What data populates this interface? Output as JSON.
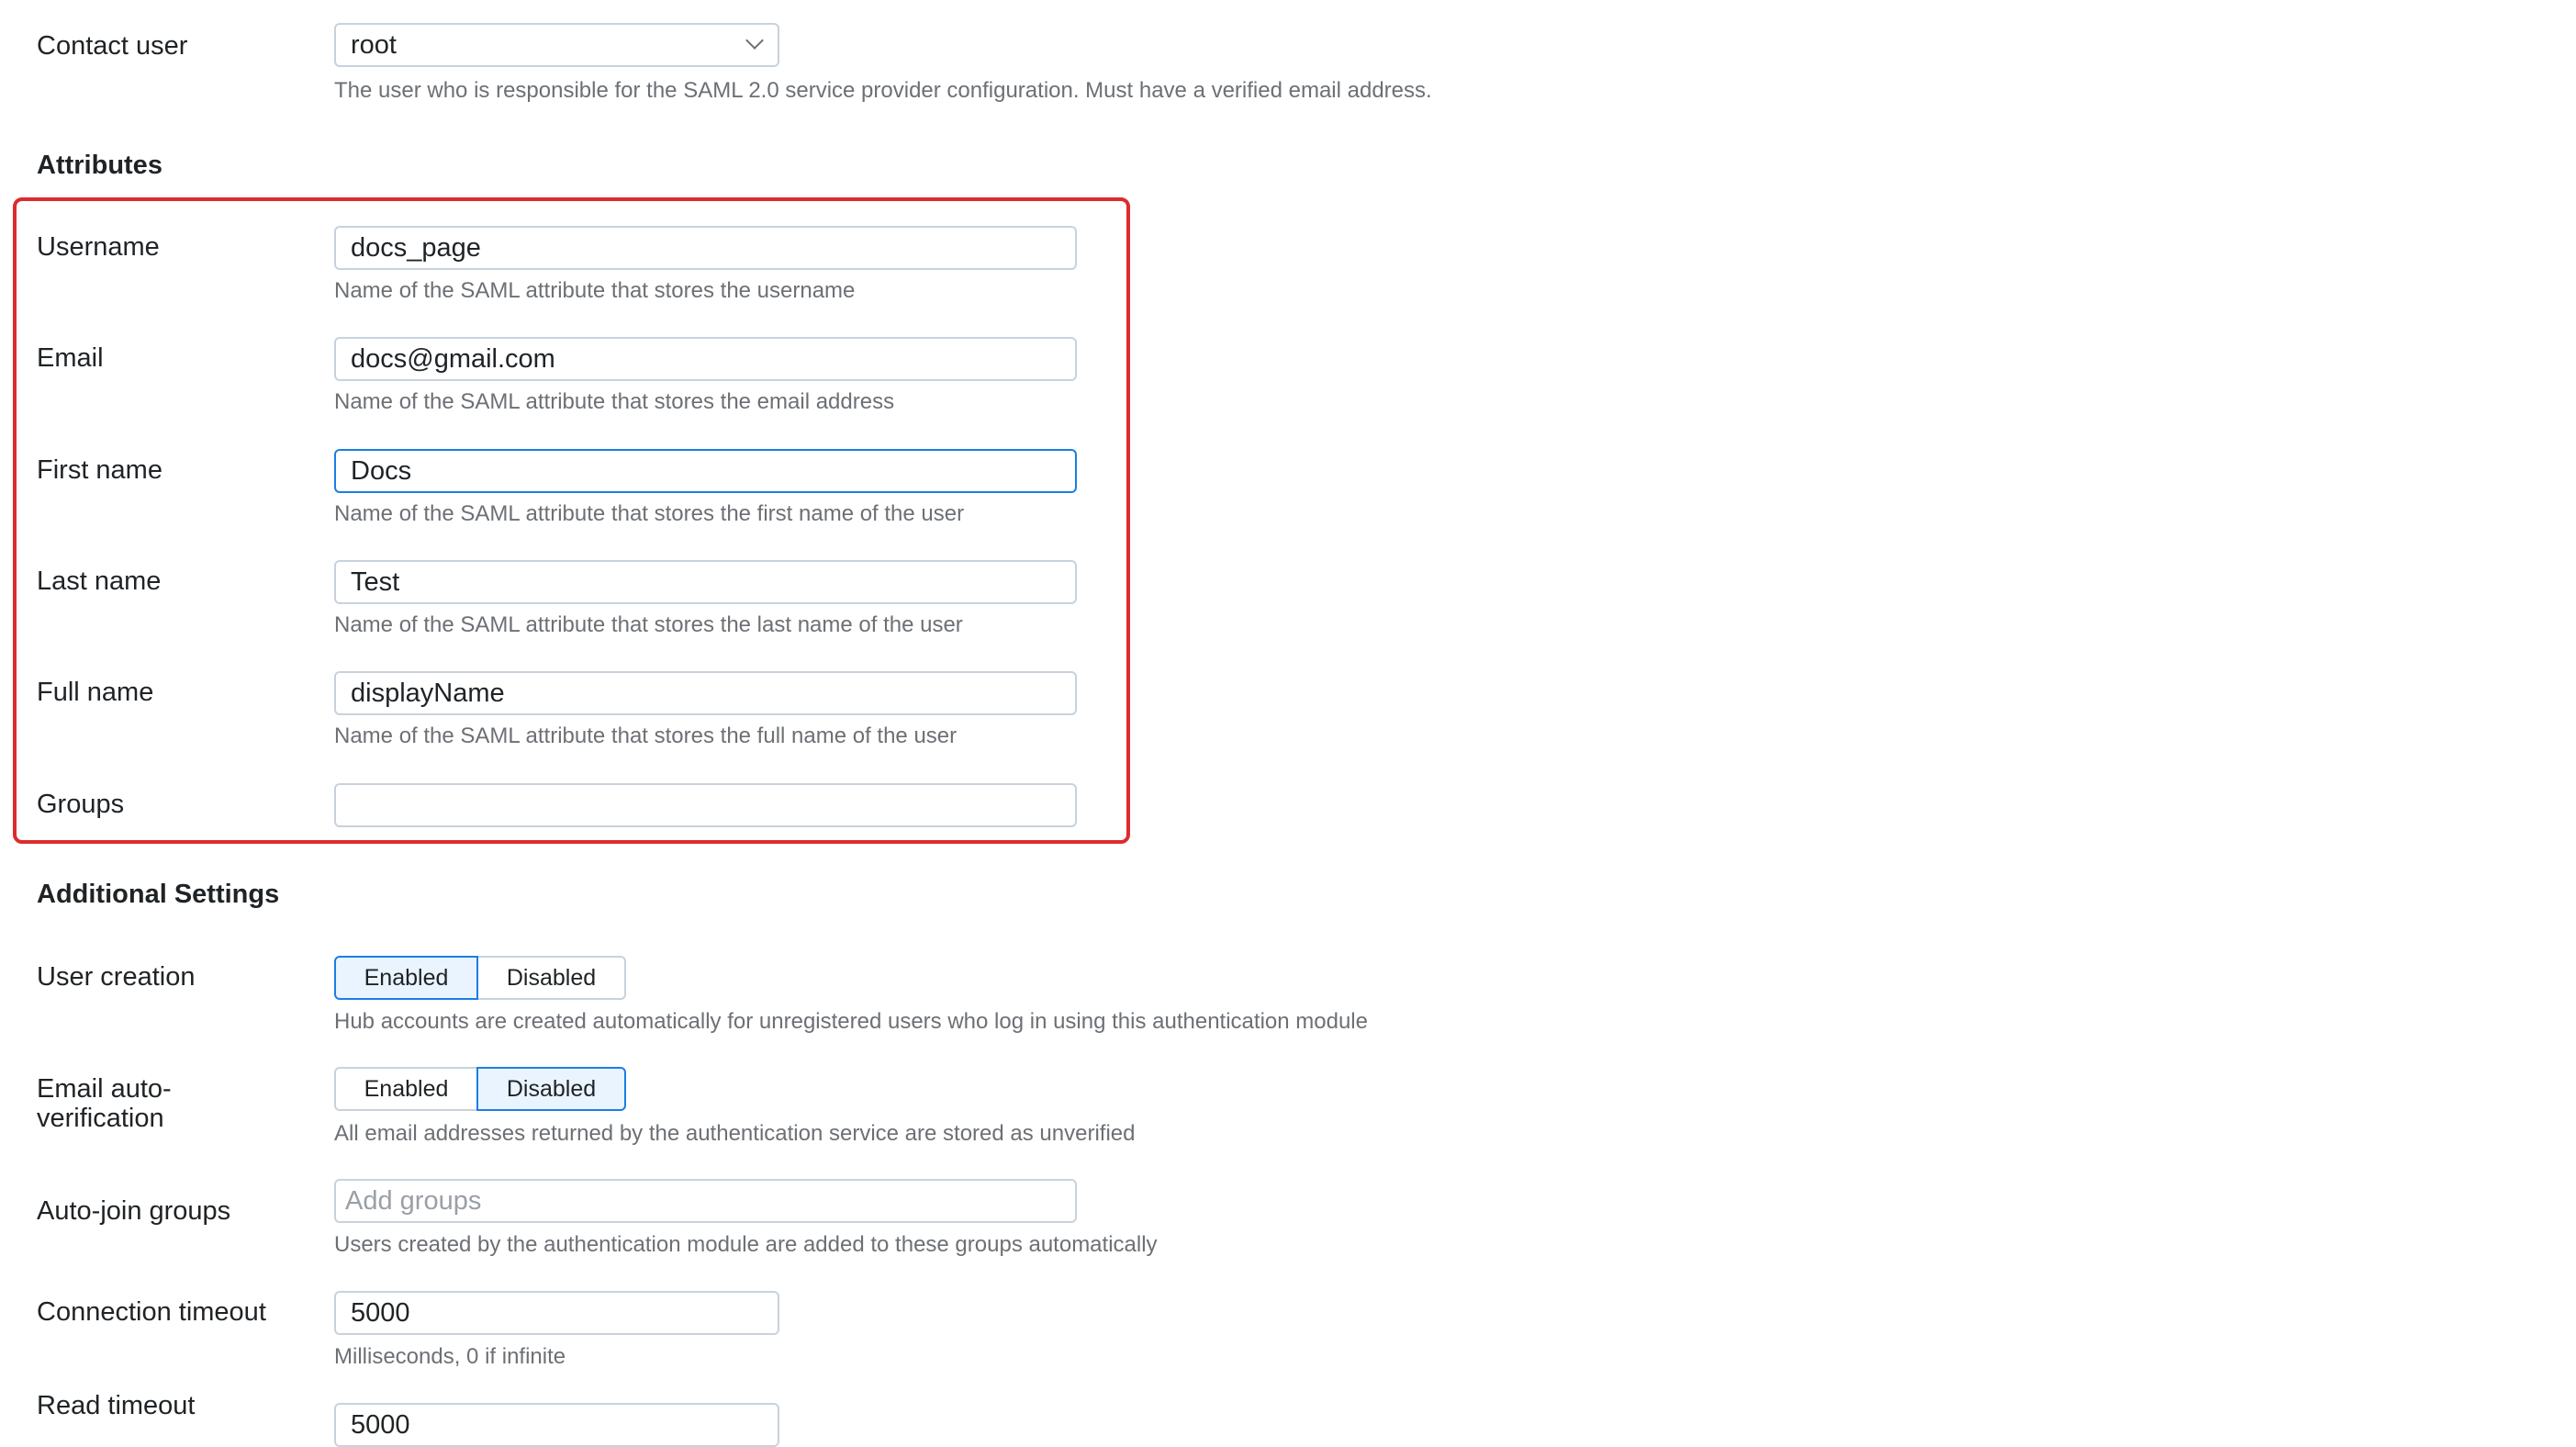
{
  "contact_user": {
    "label": "Contact user",
    "value": "root",
    "help": "The user who is responsible for the SAML 2.0 service provider configuration. Must have a verified email address."
  },
  "attributes": {
    "heading": "Attributes",
    "fields": [
      {
        "label": "Username",
        "value": "docs_page",
        "help": "Name of the SAML attribute that stores the username"
      },
      {
        "label": "Email",
        "value": "docs@gmail.com",
        "help": "Name of the SAML attribute that stores the email address"
      },
      {
        "label": "First name",
        "value": "Docs",
        "help": "Name of the SAML attribute that stores the first name of the user"
      },
      {
        "label": "Last name",
        "value": "Test",
        "help": "Name of the SAML attribute that stores the last name of the user"
      },
      {
        "label": "Full name",
        "value": "displayName",
        "help": "Name of the SAML attribute that stores the full name of the user"
      },
      {
        "label": "Groups",
        "value": ""
      }
    ],
    "highlight_color": "#dd2b2e"
  },
  "additional": {
    "heading": "Additional Settings",
    "user_creation": {
      "label": "User creation",
      "options": [
        "Enabled",
        "Disabled"
      ],
      "selected": "Enabled",
      "help": "Hub accounts are created automatically for unregistered users who log in using this authentication module"
    },
    "email_verification": {
      "label_line1": "Email auto-",
      "label_line2": "verification",
      "options": [
        "Enabled",
        "Disabled"
      ],
      "selected": "Disabled",
      "help": "All email addresses returned by the authentication service are stored as unverified"
    },
    "auto_join": {
      "label": "Auto-join groups",
      "placeholder": "Add groups",
      "help": "Users created by the authentication module are added to these groups automatically"
    },
    "connection_timeout": {
      "label": "Connection timeout",
      "value": "5000",
      "help": "Milliseconds, 0 if infinite"
    },
    "read_timeout": {
      "label": "Read timeout",
      "value": "5000"
    }
  },
  "colors": {
    "accent": "#1a7ee6",
    "selected_bg": "#eaf4fe"
  }
}
